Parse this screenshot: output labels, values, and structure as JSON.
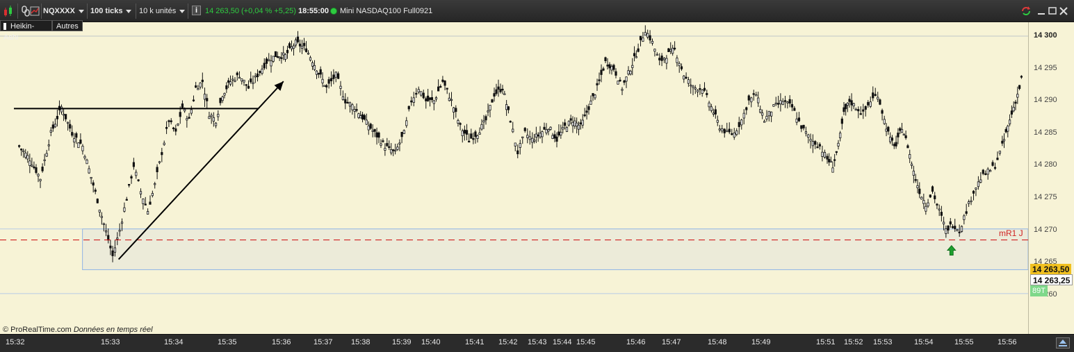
{
  "toolbar": {
    "symbol": "NQXXXX",
    "ticks": "100 ticks",
    "units": "10 k unités",
    "price_change": "14 263,50 (+0,04 % +5,25)",
    "time": "18:55:00",
    "instrument": "Mini NASDAQ100 Full0921",
    "accent": "#2ecc40"
  },
  "subbar": {
    "heikin": "Heikin-Ashi",
    "autres": "Autres"
  },
  "footer": {
    "copyright": "© ProRealTime.com",
    "realtime": "Données en temps réel"
  },
  "annotation": {
    "mr1": "mR1 J"
  },
  "price_axis": {
    "ticks": [
      "14 300",
      "14 295",
      "14 290",
      "14 285",
      "14 280",
      "14 275",
      "14 270",
      "14 265",
      "14 260"
    ],
    "last_price": "14 263,50",
    "current_price": "14 263,25",
    "volume_badge": "89T"
  },
  "time_axis": {
    "labels": [
      "15:32",
      "15:33",
      "15:34",
      "15:35",
      "15:36",
      "15:37",
      "15:38",
      "15:39",
      "15:40",
      "15:41",
      "15:42",
      "15:43",
      "15:44",
      "15:45",
      "15:46",
      "15:47",
      "15:48",
      "15:49",
      "15:51",
      "15:52",
      "15:53",
      "15:54",
      "15:55",
      "15:56"
    ]
  },
  "chart_data": {
    "type": "candlestick",
    "style": "Heikin-Ashi",
    "ylim": [
      14258,
      14303
    ],
    "x": [
      "15:32",
      "15:33",
      "15:34",
      "15:35",
      "15:36",
      "15:37",
      "15:38",
      "15:39",
      "15:40",
      "15:41",
      "15:42",
      "15:43",
      "15:44",
      "15:45",
      "15:46",
      "15:47",
      "15:48",
      "15:49",
      "15:51",
      "15:52",
      "15:53",
      "15:54",
      "15:55",
      "15:56"
    ],
    "close_path": [
      {
        "t": "15:32",
        "y": 14283
      },
      {
        "t": "15:32",
        "y": 14281
      },
      {
        "t": "15:32",
        "y": 14278
      },
      {
        "t": "15:32",
        "y": 14285
      },
      {
        "t": "15:32",
        "y": 14289
      },
      {
        "t": "15:32",
        "y": 14285
      },
      {
        "t": "15:32",
        "y": 14283
      },
      {
        "t": "15:32",
        "y": 14277
      },
      {
        "t": "15:32",
        "y": 14271
      },
      {
        "t": "15:33",
        "y": 14266
      },
      {
        "t": "15:33",
        "y": 14270
      },
      {
        "t": "15:33",
        "y": 14275
      },
      {
        "t": "15:33",
        "y": 14280
      },
      {
        "t": "15:33",
        "y": 14276
      },
      {
        "t": "15:33",
        "y": 14273
      },
      {
        "t": "15:33",
        "y": 14277
      },
      {
        "t": "15:33",
        "y": 14282
      },
      {
        "t": "15:33",
        "y": 14287
      },
      {
        "t": "15:34",
        "y": 14285
      },
      {
        "t": "15:34",
        "y": 14289
      },
      {
        "t": "15:34",
        "y": 14287
      },
      {
        "t": "15:34",
        "y": 14292
      },
      {
        "t": "15:34",
        "y": 14293
      },
      {
        "t": "15:34",
        "y": 14288
      },
      {
        "t": "15:34",
        "y": 14287
      },
      {
        "t": "15:34",
        "y": 14291
      },
      {
        "t": "15:35",
        "y": 14293
      },
      {
        "t": "15:35",
        "y": 14294
      },
      {
        "t": "15:35",
        "y": 14292
      },
      {
        "t": "15:35",
        "y": 14294
      },
      {
        "t": "15:35",
        "y": 14296
      },
      {
        "t": "15:35",
        "y": 14297
      },
      {
        "t": "15:36",
        "y": 14297
      },
      {
        "t": "15:36",
        "y": 14299
      },
      {
        "t": "15:36",
        "y": 14298
      },
      {
        "t": "15:36",
        "y": 14295
      },
      {
        "t": "15:37",
        "y": 14292
      },
      {
        "t": "15:37",
        "y": 14294
      },
      {
        "t": "15:37",
        "y": 14290
      },
      {
        "t": "15:37",
        "y": 14289
      },
      {
        "t": "15:38",
        "y": 14287
      },
      {
        "t": "15:38",
        "y": 14285
      },
      {
        "t": "15:38",
        "y": 14283
      },
      {
        "t": "15:38",
        "y": 14282
      },
      {
        "t": "15:39",
        "y": 14285
      },
      {
        "t": "15:39",
        "y": 14290
      },
      {
        "t": "15:39",
        "y": 14292
      },
      {
        "t": "15:39",
        "y": 14290
      },
      {
        "t": "15:40",
        "y": 14290
      },
      {
        "t": "15:40",
        "y": 14293
      },
      {
        "t": "15:40",
        "y": 14290
      },
      {
        "t": "15:40",
        "y": 14286
      },
      {
        "t": "15:40",
        "y": 14284
      },
      {
        "t": "15:41",
        "y": 14285
      },
      {
        "t": "15:41",
        "y": 14287
      },
      {
        "t": "15:41",
        "y": 14291
      },
      {
        "t": "15:41",
        "y": 14292
      },
      {
        "t": "15:42",
        "y": 14287
      },
      {
        "t": "15:42",
        "y": 14282
      },
      {
        "t": "15:42",
        "y": 14285
      },
      {
        "t": "15:42",
        "y": 14284
      },
      {
        "t": "15:43",
        "y": 14285
      },
      {
        "t": "15:43",
        "y": 14286
      },
      {
        "t": "15:43",
        "y": 14284
      },
      {
        "t": "15:44",
        "y": 14286
      },
      {
        "t": "15:44",
        "y": 14287
      },
      {
        "t": "15:44",
        "y": 14286
      },
      {
        "t": "15:45",
        "y": 14289
      },
      {
        "t": "15:45",
        "y": 14292
      },
      {
        "t": "15:45",
        "y": 14296
      },
      {
        "t": "15:45",
        "y": 14295
      },
      {
        "t": "15:45",
        "y": 14292
      },
      {
        "t": "15:45",
        "y": 14295
      },
      {
        "t": "15:46",
        "y": 14298
      },
      {
        "t": "15:46",
        "y": 14301
      },
      {
        "t": "15:46",
        "y": 14299
      },
      {
        "t": "15:46",
        "y": 14296
      },
      {
        "t": "15:46",
        "y": 14297
      },
      {
        "t": "15:47",
        "y": 14298
      },
      {
        "t": "15:47",
        "y": 14294
      },
      {
        "t": "15:47",
        "y": 14292
      },
      {
        "t": "15:47",
        "y": 14292
      },
      {
        "t": "15:47",
        "y": 14289
      },
      {
        "t": "15:48",
        "y": 14286
      },
      {
        "t": "15:48",
        "y": 14285
      },
      {
        "t": "15:48",
        "y": 14285
      },
      {
        "t": "15:48",
        "y": 14287
      },
      {
        "t": "15:48",
        "y": 14290
      },
      {
        "t": "15:48",
        "y": 14291
      },
      {
        "t": "15:49",
        "y": 14287
      },
      {
        "t": "15:49",
        "y": 14289
      },
      {
        "t": "15:49",
        "y": 14290
      },
      {
        "t": "15:49",
        "y": 14289
      },
      {
        "t": "15:49",
        "y": 14286
      },
      {
        "t": "15:49",
        "y": 14284
      },
      {
        "t": "15:49",
        "y": 14283
      },
      {
        "t": "15:51",
        "y": 14281
      },
      {
        "t": "15:51",
        "y": 14280
      },
      {
        "t": "15:51",
        "y": 14283
      },
      {
        "t": "15:51",
        "y": 14288
      },
      {
        "t": "15:51",
        "y": 14290
      },
      {
        "t": "15:52",
        "y": 14289
      },
      {
        "t": "15:52",
        "y": 14288
      },
      {
        "t": "15:52",
        "y": 14290
      },
      {
        "t": "15:52",
        "y": 14291
      },
      {
        "t": "15:53",
        "y": 14287
      },
      {
        "t": "15:53",
        "y": 14284
      },
      {
        "t": "15:53",
        "y": 14283
      },
      {
        "t": "15:53",
        "y": 14286
      },
      {
        "t": "15:53",
        "y": 14283
      },
      {
        "t": "15:53",
        "y": 14279
      },
      {
        "t": "15:53",
        "y": 14276
      },
      {
        "t": "15:54",
        "y": 14274
      },
      {
        "t": "15:54",
        "y": 14276
      },
      {
        "t": "15:54",
        "y": 14273
      },
      {
        "t": "15:54",
        "y": 14270
      },
      {
        "t": "15:54",
        "y": 14271
      },
      {
        "t": "15:54",
        "y": 14270
      },
      {
        "t": "15:55",
        "y": 14273
      },
      {
        "t": "15:55",
        "y": 14276
      },
      {
        "t": "15:55",
        "y": 14278
      },
      {
        "t": "15:55",
        "y": 14279
      },
      {
        "t": "15:55",
        "y": 14280
      },
      {
        "t": "15:55",
        "y": 14283
      },
      {
        "t": "15:56",
        "y": 14286
      },
      {
        "t": "15:56",
        "y": 14288
      },
      {
        "t": "15:56",
        "y": 14290
      },
      {
        "t": "15:56",
        "y": 14292
      },
      {
        "t": "15:56",
        "y": 14295
      }
    ],
    "hlines": [
      {
        "name": "resistance-line",
        "y": 14288.8,
        "color": "#000000",
        "from": "15:32",
        "to": "15:35"
      },
      {
        "name": "mR1 J",
        "y": 14268.5,
        "color": "#d02020",
        "style": "dashed"
      }
    ],
    "zone": {
      "y_top": 14270.2,
      "y_bottom": 14263.9,
      "color": "#8fb4e6"
    },
    "h_light_line": 14260.2,
    "trend_arrow": {
      "from": {
        "t": "15:33",
        "y": 14265.5
      },
      "to": {
        "t": "15:36",
        "y": 14293
      }
    },
    "buy_arrow": {
      "t": "15:54",
      "y": 14267,
      "color": "#1e9e2e"
    },
    "grid": false
  }
}
